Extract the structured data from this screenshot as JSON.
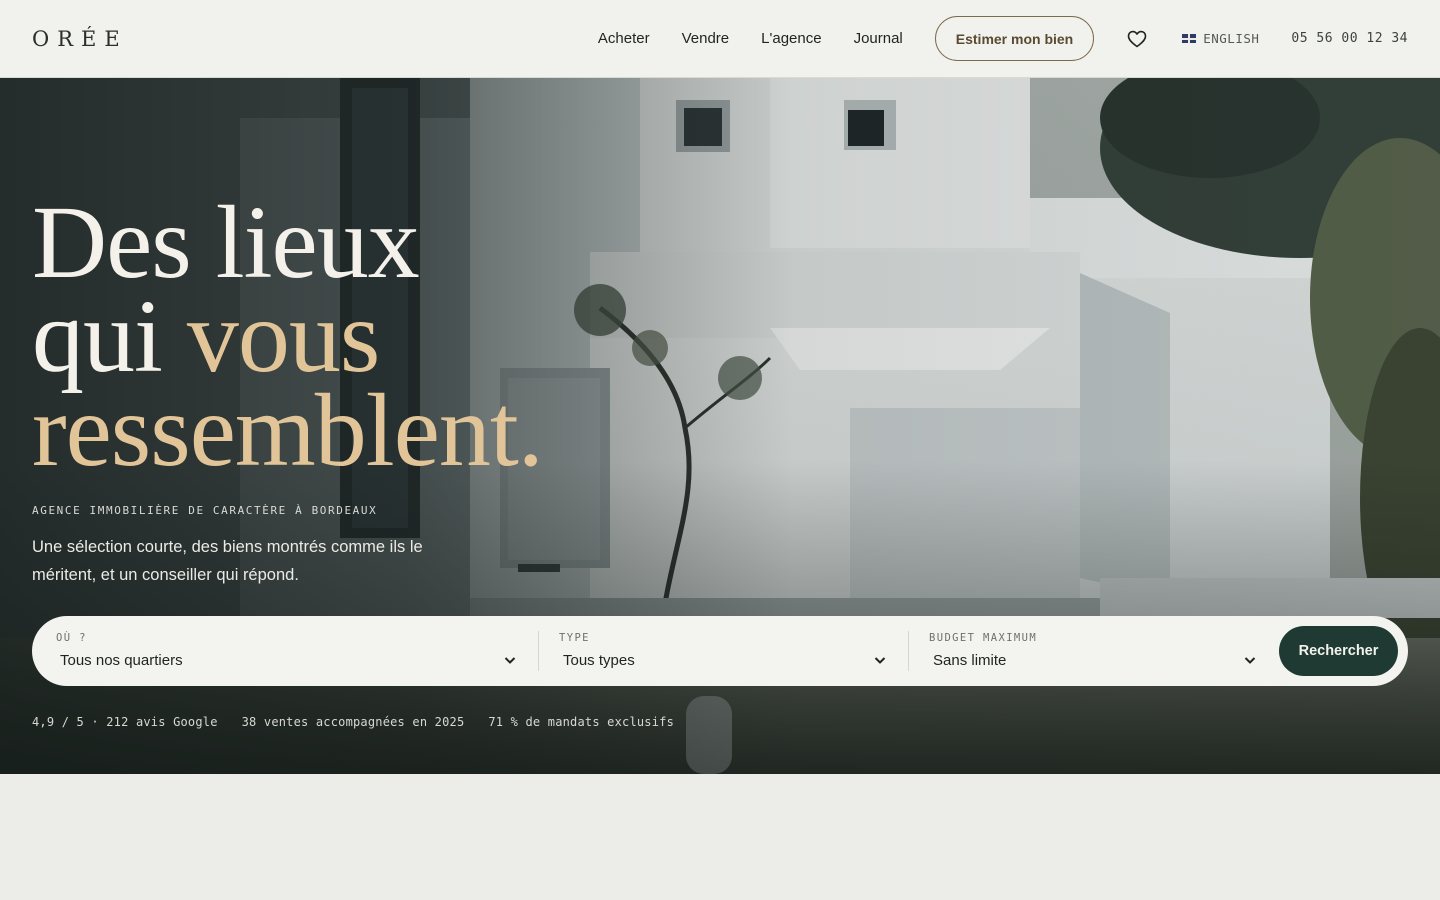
{
  "header": {
    "logo": "ORÉE",
    "nav": [
      {
        "label": "Acheter"
      },
      {
        "label": "Vendre"
      },
      {
        "label": "L'agence"
      },
      {
        "label": "Journal"
      }
    ],
    "cta_label": "Estimer mon bien",
    "favorites_icon": "heart-icon",
    "language_label": "ENGLISH",
    "language_flag_icon": "uk-flag-icon",
    "phone": "05 56 00 12 34"
  },
  "hero": {
    "headline_line1": "Des lieux",
    "headline_line2_a": "qui ",
    "headline_line2_b": "vous",
    "headline_line3": "ressemblent.",
    "eyebrow": "AGENCE IMMOBILIÈRE DE CARACTÈRE À BORDEAUX",
    "lead": "Une sélection courte, des biens montrés comme ils le méritent, et un conseiller qui répond."
  },
  "search": {
    "where": {
      "label": "OÙ ?",
      "value": "Tous nos quartiers"
    },
    "type": {
      "label": "TYPE",
      "value": "Tous types"
    },
    "budget": {
      "label": "BUDGET MAXIMUM",
      "value": "Sans limite"
    },
    "button_label": "Rechercher"
  },
  "stats": [
    "4,9 / 5 · 212 avis Google",
    "38 ventes accompagnées en 2025",
    "71 % de mandats exclusifs"
  ],
  "colors": {
    "accent_gold": "#e1c598",
    "primary_dark_green": "#1f3a33",
    "page_background": "#ecede8"
  }
}
